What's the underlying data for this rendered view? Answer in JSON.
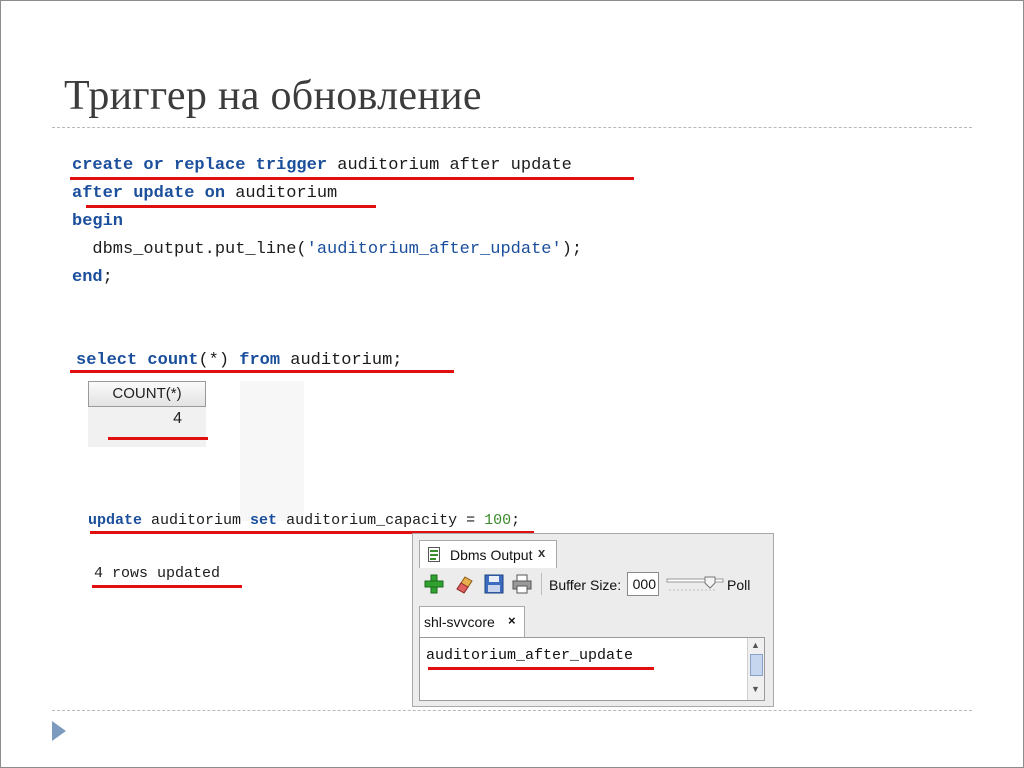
{
  "slide": {
    "title": "Триггер на обновление"
  },
  "trigger_code": {
    "l1_kw": "create or replace trigger",
    "l1_rest": " auditorium after update",
    "l2_kw1": "after update",
    "l2_kw2": "on",
    "l2_rest": " auditorium",
    "l3_kw": "begin",
    "l4_a": "  dbms_output.put_line(",
    "l4_str": "'auditorium_after_update'",
    "l4_b": ");",
    "l5_kw": "end",
    "l5_rest": ";"
  },
  "select_query": {
    "kw1": "select",
    "kw2": "count",
    "mid": "(*)",
    "kw3": "from",
    "rest": " auditorium;"
  },
  "result_grid": {
    "column_header": "COUNT(*)",
    "value": "4"
  },
  "update_stmt": {
    "kw1": "update",
    "mid1": " auditorium ",
    "kw2": "set",
    "mid2": " auditorium_capacity = ",
    "num": "100",
    "end": ";"
  },
  "rows_updated": "4 rows updated",
  "dbms_panel": {
    "tab_label": "Dbms Output",
    "tab_close": "x",
    "buffer_label": "Buffer Size:",
    "buffer_value": "000",
    "poll_label": "Poll",
    "connection_tab": "shl-svvcore",
    "connection_close": "×",
    "output": "auditorium_after_update"
  },
  "colors": {
    "keyword": "#1b4f9c",
    "underline": "#e01010",
    "number": "#3b8a2a"
  }
}
